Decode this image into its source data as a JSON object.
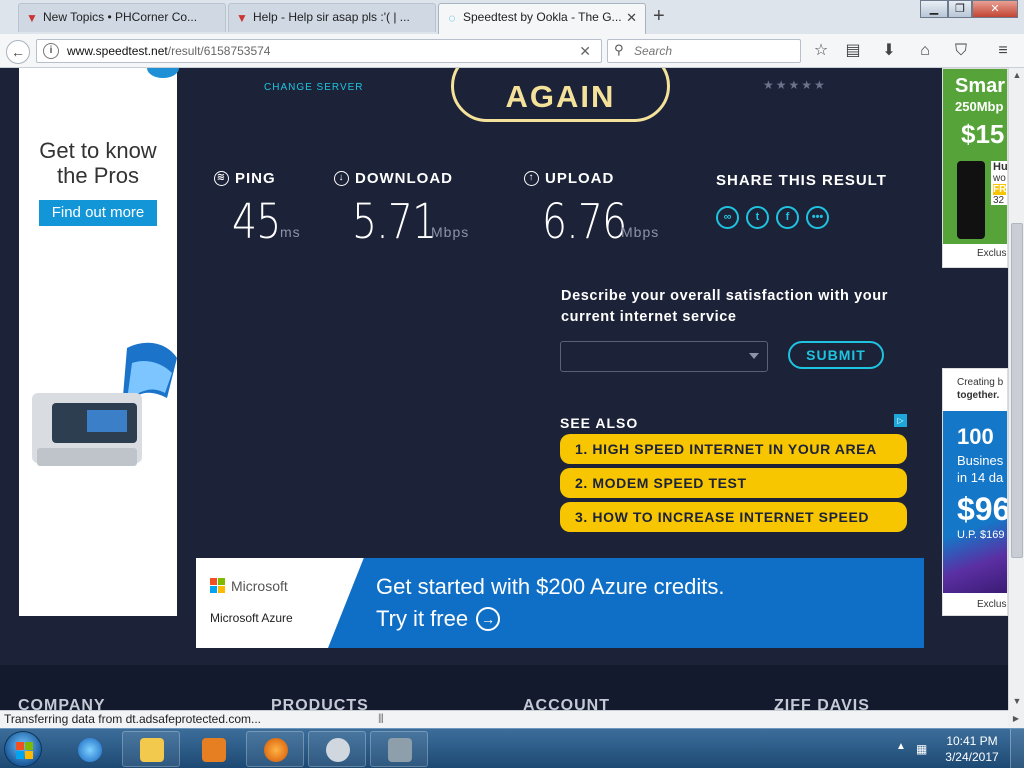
{
  "browser": {
    "tabs": [
      {
        "title": "New Topics • PHCorner Co..."
      },
      {
        "title": "Help - Help sir asap pls :'( | ..."
      },
      {
        "title": "Speedtest by Ookla - The G..."
      }
    ],
    "new_tab": "+",
    "url_host": "www.speedtest.net",
    "url_path": "/result/6158753574",
    "search_placeholder": "Search",
    "status_text": "Transferring data from dt.adsafeprotected.com..."
  },
  "speedtest": {
    "again_label": "AGAIN",
    "change_server": "CHANGE SERVER",
    "stars": "★★★★★",
    "ping": {
      "label": "PING",
      "value": "45",
      "unit": "ms"
    },
    "download": {
      "label": "DOWNLOAD",
      "value": "5.71",
      "unit": "Mbps"
    },
    "upload": {
      "label": "UPLOAD",
      "value": "6.76",
      "unit": "Mbps"
    },
    "share_title": "SHARE THIS RESULT",
    "survey_question": "Describe your overall satisfaction with your current internet service",
    "survey_selected": "",
    "submit_label": "SUBMIT",
    "see_also_title": "SEE ALSO",
    "see_also_links": [
      "1. HIGH SPEED INTERNET IN YOUR AREA",
      "2. MODEM SPEED TEST",
      "3. HOW TO INCREASE INTERNET SPEED"
    ]
  },
  "ads": {
    "left_headline_1": "Get to know",
    "left_headline_2": "the Pros",
    "left_cta": "Find out more",
    "ms_brand": "Microsoft",
    "ms_product": "Microsoft Azure",
    "ms_line1": "Get started with $200 Azure credits.",
    "ms_line2": "Try it free",
    "right1_line1": "Smar",
    "right1_line2": "250Mbp",
    "right1_price": "$15",
    "right1_badge_1": "Hu",
    "right1_badge_2": "wo",
    "right1_badge_3": "FR",
    "right1_badge_4": "32",
    "right1_footer": "Exclus",
    "right2_line1": "Creating b",
    "right2_line2": "together.",
    "right2_big": "100",
    "right2_sub1": "Busines",
    "right2_sub2": "in 14 da",
    "right2_price": "$96",
    "right2_small": "U.P. $169",
    "right2_footer": "Exclusi"
  },
  "footer": {
    "columns": [
      "COMPANY",
      "PRODUCTS",
      "ACCOUNT",
      "ZIFF DAVIS"
    ]
  },
  "taskbar": {
    "time": "10:41 PM",
    "date": "3/24/2017"
  },
  "colors": {
    "page_bg": "#1c2237",
    "accent_cyan": "#1fc3e0",
    "again_yellow": "#f5e29a",
    "link_yellow": "#f7c600"
  }
}
